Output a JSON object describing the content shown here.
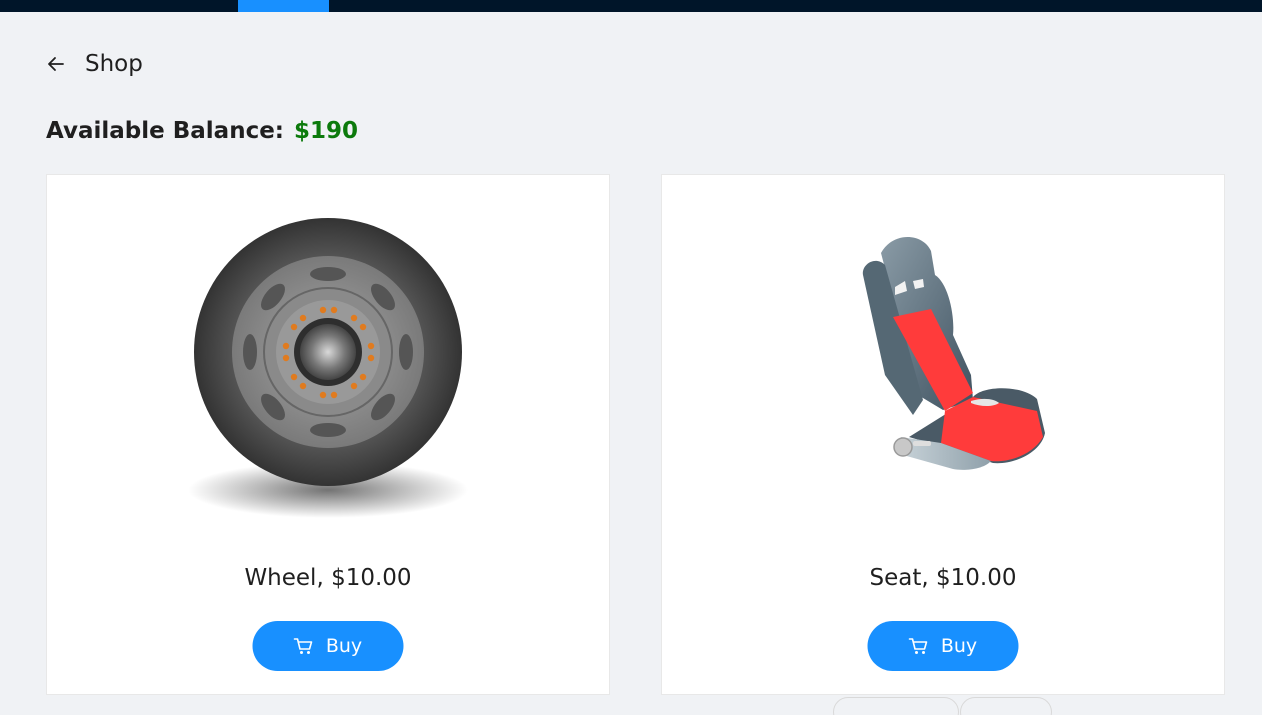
{
  "header": {
    "title": "Shop",
    "back_icon": "arrow-left-icon"
  },
  "balance": {
    "label": "Available Balance:",
    "value": "$190",
    "value_color": "#0c7a0c"
  },
  "colors": {
    "topbar": "#001529",
    "accent": "#1890ff",
    "background": "#f0f2f5"
  },
  "products": [
    {
      "title": "Wheel, $10.00",
      "buy_label": "Buy",
      "image_icon": "wheel-image"
    },
    {
      "title": "Seat, $10.00",
      "buy_label": "Buy",
      "image_icon": "seat-image"
    }
  ]
}
